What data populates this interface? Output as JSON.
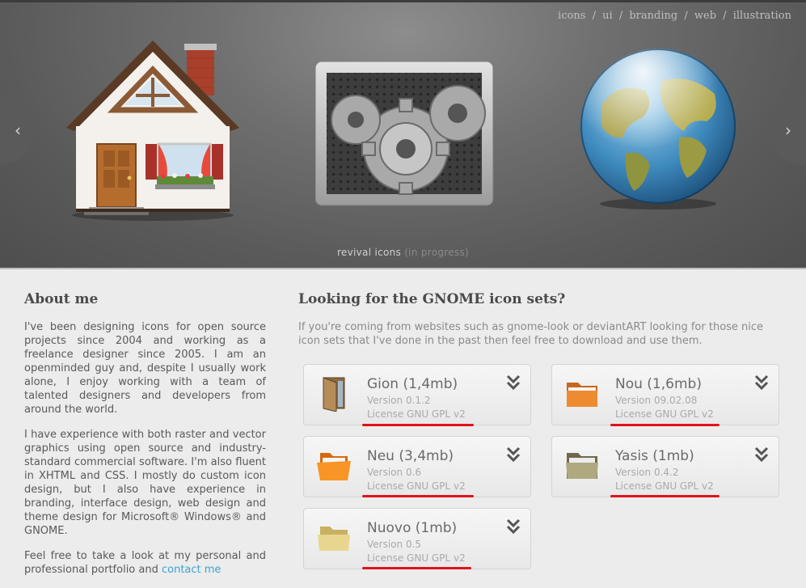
{
  "hero": {
    "nav": [
      "icons",
      "ui",
      "branding",
      "web",
      "illustration"
    ],
    "separator": "/",
    "caption_main": "revival icons",
    "caption_dim": "(in progress)",
    "prev_glyph": "‹",
    "next_glyph": "›"
  },
  "about": {
    "heading": "About me",
    "p1": "I've been designing icons for open source projects since 2004 and working as a freelance designer since 2005. I am an openminded guy and, despite I usually work alone, I enjoy working with a team of talented designers and developers from around the world.",
    "p2": "I have experience with both raster and vector graphics using open source and industry-standard commercial software. I'm also fluent in XHTML and CSS. I mostly do custom icon design, but I also have experience in branding, interface design, web design and theme design for Microsoft® Windows® and GNOME.",
    "p3_text": "Feel free to take a look at my personal and professional portfolio and ",
    "p3_link": "contact me"
  },
  "gnome": {
    "heading": "Looking for the GNOME icon sets?",
    "intro": "If you're coming from websites such as gnome-look or deviantART looking for those nice icon sets that I've done in the past then feel free to download and use them.",
    "sets": [
      {
        "title": "Gion (1,4mb)",
        "version": "Version 0.1.2",
        "license": "License GNU GPL v2",
        "icon": "gion-folder-icon"
      },
      {
        "title": "Nou (1,6mb)",
        "version": "Version 09.02.08",
        "license": "License GNU GPL v2",
        "icon": "nou-folder-icon"
      },
      {
        "title": "Neu (3,4mb)",
        "version": "Version 0.6",
        "license": "License GNU GPL v2",
        "icon": "neu-folder-icon"
      },
      {
        "title": "Yasis (1mb)",
        "version": "Version 0.4.2",
        "license": "License GNU GPL v2",
        "icon": "yasis-folder-icon"
      },
      {
        "title": "Nuovo (1mb)",
        "version": "Version 0.5",
        "license": "License GNU GPL v2",
        "icon": "nuovo-folder-icon"
      }
    ]
  },
  "colors": {
    "accent_link": "#3aa2d2",
    "underline": "#e0121b"
  }
}
